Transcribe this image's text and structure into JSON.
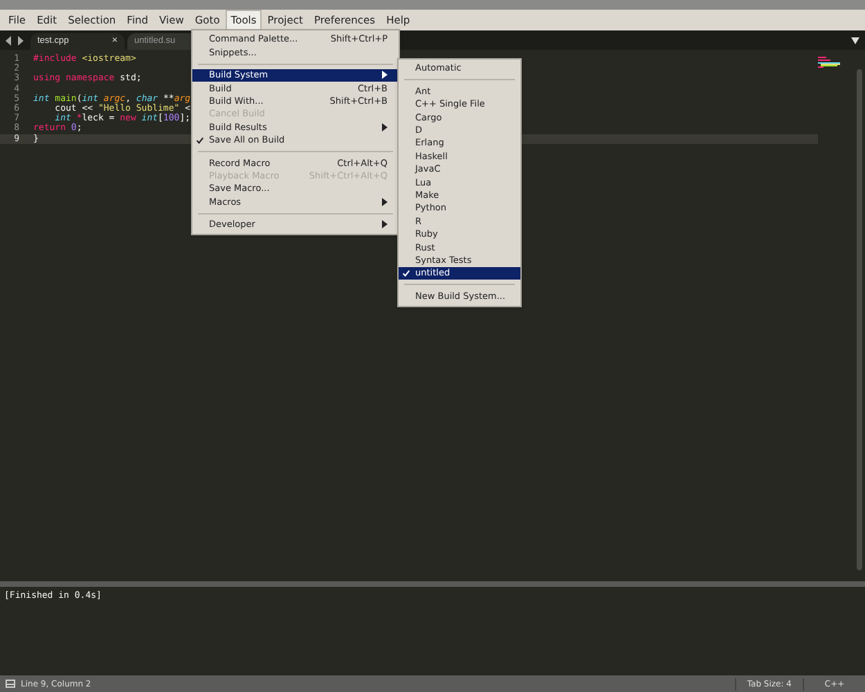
{
  "menubar": [
    {
      "label": "File",
      "selected": false
    },
    {
      "label": "Edit",
      "selected": false
    },
    {
      "label": "Selection",
      "selected": false
    },
    {
      "label": "Find",
      "selected": false
    },
    {
      "label": "View",
      "selected": false
    },
    {
      "label": "Goto",
      "selected": false
    },
    {
      "label": "Tools",
      "selected": true
    },
    {
      "label": "Project",
      "selected": false
    },
    {
      "label": "Preferences",
      "selected": false
    },
    {
      "label": "Help",
      "selected": false
    }
  ],
  "tabs": [
    {
      "label": "test.cpp",
      "selected": true,
      "close": "×"
    },
    {
      "label": "untitled.su",
      "selected": false
    }
  ],
  "code": [
    {
      "number": "1",
      "current": false,
      "tokens": [
        {
          "kind": "keyword",
          "text": "#include"
        },
        {
          "kind": "string",
          "text": " <iostream>"
        }
      ]
    },
    {
      "number": "2",
      "current": false
    },
    {
      "number": "3",
      "current": false,
      "tokens": [
        {
          "kind": "keyword",
          "text": "using"
        },
        {
          "kind": "keyword",
          "text": " namespace"
        },
        {
          "kind": "plain",
          "text": " std;"
        }
      ]
    },
    {
      "number": "4",
      "current": false
    },
    {
      "number": "5",
      "current": false,
      "tokens": [
        {
          "kind": "type",
          "text": "int"
        },
        {
          "kind": "function",
          "text": " main"
        },
        {
          "kind": "plain",
          "text": "("
        },
        {
          "kind": "type",
          "text": "int"
        },
        {
          "kind": "param",
          "text": " argc"
        },
        {
          "kind": "plain",
          "text": ", "
        },
        {
          "kind": "type",
          "text": "char"
        },
        {
          "kind": "plain",
          "text": " **"
        },
        {
          "kind": "param",
          "text": "arg"
        }
      ]
    },
    {
      "number": "6",
      "current": false,
      "tokens": [
        {
          "kind": "plain",
          "text": "    cout << "
        },
        {
          "kind": "string",
          "text": "\"Hello Sublime\""
        },
        {
          "kind": "plain",
          "text": " <"
        }
      ]
    },
    {
      "number": "7",
      "current": false,
      "tokens": [
        {
          "kind": "type",
          "text": "    int"
        },
        {
          "kind": "keyword",
          "text": " *"
        },
        {
          "kind": "plain",
          "text": "leck = "
        },
        {
          "kind": "keyword",
          "text": "new"
        },
        {
          "kind": "type",
          "text": " int"
        },
        {
          "kind": "plain",
          "text": "["
        },
        {
          "kind": "number",
          "text": "100"
        },
        {
          "kind": "plain",
          "text": "];"
        }
      ]
    },
    {
      "number": "8",
      "current": false,
      "tokens": [
        {
          "kind": "keyword",
          "text": "return"
        },
        {
          "kind": "number",
          "text": " 0"
        },
        {
          "kind": "plain",
          "text": ";"
        }
      ]
    },
    {
      "number": "9",
      "current": true,
      "tokens": [
        {
          "kind": "plain",
          "text": "}"
        }
      ]
    }
  ],
  "tools_menu": [
    {
      "kind": "item",
      "label": "Command Palette...",
      "shortcut": "Shift+Ctrl+P",
      "selected": false,
      "disabled": false,
      "submenu": false,
      "checked": false
    },
    {
      "kind": "item",
      "label": "Snippets...",
      "selected": false,
      "disabled": false,
      "submenu": false,
      "checked": false
    },
    {
      "kind": "separator"
    },
    {
      "kind": "item",
      "label": "Build System",
      "selected": true,
      "disabled": false,
      "submenu": true,
      "checked": false
    },
    {
      "kind": "item",
      "label": "Build",
      "shortcut": "Ctrl+B",
      "selected": false,
      "disabled": false,
      "submenu": false,
      "checked": false
    },
    {
      "kind": "item",
      "label": "Build With...",
      "shortcut": "Shift+Ctrl+B",
      "selected": false,
      "disabled": false,
      "submenu": false,
      "checked": false
    },
    {
      "kind": "item",
      "label": "Cancel Build",
      "selected": false,
      "disabled": true,
      "submenu": false,
      "checked": false
    },
    {
      "kind": "item",
      "label": "Build Results",
      "selected": false,
      "disabled": false,
      "submenu": true,
      "checked": false
    },
    {
      "kind": "item",
      "label": "Save All on Build",
      "selected": false,
      "disabled": false,
      "submenu": false,
      "checked": true
    },
    {
      "kind": "separator"
    },
    {
      "kind": "item",
      "label": "Record Macro",
      "shortcut": "Ctrl+Alt+Q",
      "selected": false,
      "disabled": false,
      "submenu": false,
      "checked": false
    },
    {
      "kind": "item",
      "label": "Playback Macro",
      "shortcut": "Shift+Ctrl+Alt+Q",
      "selected": false,
      "disabled": true,
      "submenu": false,
      "checked": false
    },
    {
      "kind": "item",
      "label": "Save Macro...",
      "selected": false,
      "disabled": false,
      "submenu": false,
      "checked": false
    },
    {
      "kind": "item",
      "label": "Macros",
      "selected": false,
      "disabled": false,
      "submenu": true,
      "checked": false
    },
    {
      "kind": "separator"
    },
    {
      "kind": "item",
      "label": "Developer",
      "selected": false,
      "disabled": false,
      "submenu": true,
      "checked": false
    }
  ],
  "build_system_menu": [
    {
      "kind": "item",
      "label": "Automatic",
      "selected": false,
      "checked": false
    },
    {
      "kind": "separator"
    },
    {
      "kind": "item",
      "label": "Ant",
      "selected": false,
      "checked": false
    },
    {
      "kind": "item",
      "label": "C++ Single File",
      "selected": false,
      "checked": false
    },
    {
      "kind": "item",
      "label": "Cargo",
      "selected": false,
      "checked": false
    },
    {
      "kind": "item",
      "label": "D",
      "selected": false,
      "checked": false
    },
    {
      "kind": "item",
      "label": "Erlang",
      "selected": false,
      "checked": false
    },
    {
      "kind": "item",
      "label": "Haskell",
      "selected": false,
      "checked": false
    },
    {
      "kind": "item",
      "label": "JavaC",
      "selected": false,
      "checked": false
    },
    {
      "kind": "item",
      "label": "Lua",
      "selected": false,
      "checked": false
    },
    {
      "kind": "item",
      "label": "Make",
      "selected": false,
      "checked": false
    },
    {
      "kind": "item",
      "label": "Python",
      "selected": false,
      "checked": false
    },
    {
      "kind": "item",
      "label": "R",
      "selected": false,
      "checked": false
    },
    {
      "kind": "item",
      "label": "Ruby",
      "selected": false,
      "checked": false
    },
    {
      "kind": "item",
      "label": "Rust",
      "selected": false,
      "checked": false
    },
    {
      "kind": "item",
      "label": "Syntax Tests",
      "selected": false,
      "checked": false
    },
    {
      "kind": "item",
      "label": "untitled",
      "selected": true,
      "checked": true
    },
    {
      "kind": "separator"
    },
    {
      "kind": "item",
      "label": "New Build System...",
      "selected": false,
      "checked": false
    }
  ],
  "output": "[Finished in 0.4s]",
  "status_bar": {
    "position": "Line 9, Column 2",
    "tab_size": "Tab Size: 4",
    "syntax": "C++"
  }
}
